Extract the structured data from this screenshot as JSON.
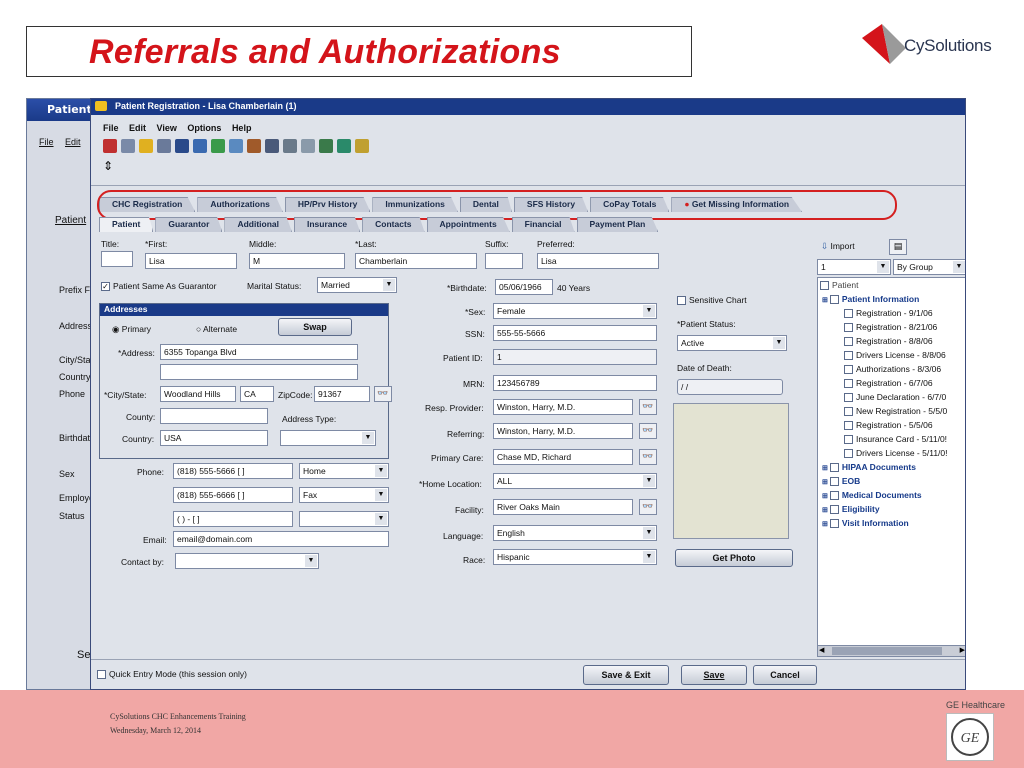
{
  "slide": {
    "title": "Referrals and Authorizations",
    "logo_text": "CySolutions",
    "footer_line1": "CySolutions CHC Enhancements Training",
    "footer_line2": "Wednesday, March 12, 2014",
    "ge_label": "GE Healthcare"
  },
  "back_window": {
    "title": "Patient I",
    "menu": [
      "File",
      "Edit"
    ],
    "patient_tab": "Patient",
    "labels": [
      "Prefix  F",
      "Address",
      "City/Stat",
      "Country",
      "Phone",
      "Birthdate",
      "Sex",
      "Employe",
      "Status",
      "Sel"
    ]
  },
  "window": {
    "title": "Patient Registration - Lisa Chamberlain (1)",
    "menu": [
      "File",
      "Edit",
      "View",
      "Options",
      "Help"
    ],
    "tabs_row1": [
      "CHC Registration",
      "Authorizations",
      "HP/Prv History",
      "Immunizations",
      "Dental",
      "SFS History",
      "CoPay Totals",
      "Get Missing Information"
    ],
    "tabs_row2": [
      "Patient",
      "Guarantor",
      "Additional",
      "Insurance",
      "Contacts",
      "Appointments",
      "Financial",
      "Payment Plan"
    ]
  },
  "form": {
    "title_label": "Title:",
    "first_label": "*First:",
    "first_value": "Lisa",
    "middle_label": "Middle:",
    "middle_value": "M",
    "last_label": "*Last:",
    "last_value": "Chamberlain",
    "suffix_label": "Suffix:",
    "preferred_label": "Preferred:",
    "preferred_value": "Lisa",
    "same_guarantor": "Patient Same As Guarantor",
    "marital_label": "Marital Status:",
    "marital_value": "Married",
    "birthdate_label": "*Birthdate:",
    "birthdate_value": "05/06/1966",
    "age_value": "40 Years",
    "addresses_title": "Addresses",
    "primary_label": "Primary",
    "alternate_label": "Alternate",
    "swap_label": "Swap",
    "address_label": "*Address:",
    "address_value": "6355 Topanga Blvd",
    "citystate_label": "*City/State:",
    "city_value": "Woodland Hills",
    "state_value": "CA",
    "zip_label": "ZipCode:",
    "zip_value": "91367",
    "county_label": "County:",
    "address_type_label": "Address Type:",
    "country_label": "Country:",
    "country_value": "USA",
    "phone_label": "Phone:",
    "phone1": "(818) 555-5666 [   ]",
    "phone1_type": "Home",
    "phone2": "(818) 555-6666 [   ]",
    "phone2_type": "Fax",
    "phone3": "(   )   -    [   ]",
    "email_label": "Email:",
    "email_value": "email@domain.com",
    "contactby_label": "Contact by:",
    "sex_label": "*Sex:",
    "sex_value": "Female",
    "ssn_label": "SSN:",
    "ssn_value": "555-55-5666",
    "patientid_label": "Patient ID:",
    "patientid_value": "1",
    "mrn_label": "MRN:",
    "mrn_value": "123456789",
    "resp_label": "Resp. Provider:",
    "resp_value": "Winston, Harry, M.D.",
    "referring_label": "Referring:",
    "referring_value": "Winston, Harry, M.D.",
    "primarycare_label": "Primary Care:",
    "primarycare_value": "Chase MD, Richard",
    "homeloc_label": "*Home Location:",
    "homeloc_value": "ALL",
    "facility_label": "Facility:",
    "facility_value": "River Oaks Main",
    "language_label": "Language:",
    "language_value": "English",
    "race_label": "Race:",
    "race_value": "Hispanic",
    "sensitive_label": "Sensitive Chart",
    "status_label": "*Patient Status:",
    "status_value": "Active",
    "death_label": "Date of Death:",
    "death_value": "/ /",
    "get_photo": "Get Photo",
    "quick_entry": "Quick Entry Mode (this session only)",
    "save_exit": "Save & Exit",
    "save": "Save",
    "cancel": "Cancel"
  },
  "tree": {
    "import_label": "Import",
    "group_num": "1",
    "group_by": "By Group",
    "root": "Patient",
    "items": [
      {
        "text": "Patient Information",
        "head": true,
        "indent": 0
      },
      {
        "text": "Registration - 9/1/06",
        "head": false,
        "indent": 1
      },
      {
        "text": "Registration - 8/21/06",
        "head": false,
        "indent": 1
      },
      {
        "text": "Registration - 8/8/06",
        "head": false,
        "indent": 1
      },
      {
        "text": "Drivers License - 8/8/06",
        "head": false,
        "indent": 1
      },
      {
        "text": "Authorizations - 8/3/06",
        "head": false,
        "indent": 1
      },
      {
        "text": "Registration - 6/7/06",
        "head": false,
        "indent": 1
      },
      {
        "text": "June Declaration - 6/7/0",
        "head": false,
        "indent": 1
      },
      {
        "text": "New Registration - 5/5/0",
        "head": false,
        "indent": 1
      },
      {
        "text": "Registration - 5/5/06",
        "head": false,
        "indent": 1
      },
      {
        "text": "Insurance Card - 5/11/0!",
        "head": false,
        "indent": 1
      },
      {
        "text": "Drivers License - 5/11/0!",
        "head": false,
        "indent": 1
      },
      {
        "text": "HIPAA Documents",
        "head": true,
        "indent": 0
      },
      {
        "text": "EOB",
        "head": true,
        "indent": 0
      },
      {
        "text": "Medical Documents",
        "head": true,
        "indent": 0
      },
      {
        "text": "Eligibility",
        "head": true,
        "indent": 0
      },
      {
        "text": "Visit Information",
        "head": true,
        "indent": 0
      }
    ]
  }
}
